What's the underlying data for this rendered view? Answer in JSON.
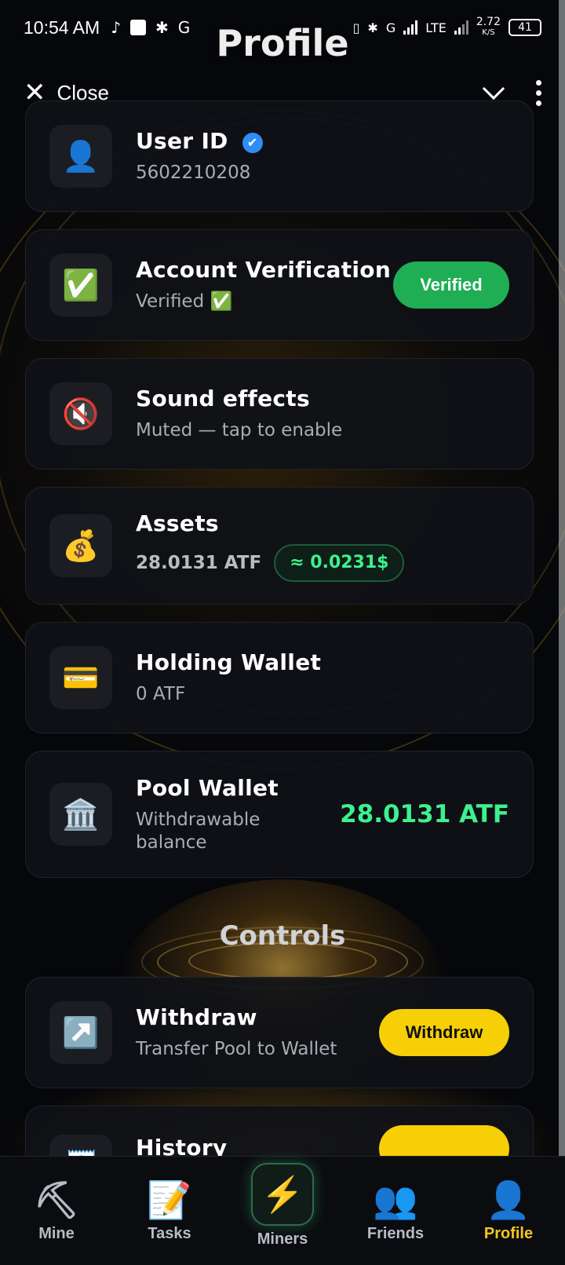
{
  "status_bar": {
    "time": "10:54 AM",
    "network_speed": "2.72",
    "network_speed_unit": "K/S",
    "battery": "41",
    "lte": "LTE",
    "g": "G"
  },
  "header": {
    "title": "Profile",
    "close_label": "Close"
  },
  "cards": {
    "user_id": {
      "title": "User ID",
      "value": "5602210208",
      "icon": "👤"
    },
    "verification": {
      "title": "Account Verification",
      "subtitle": "Verified ✅",
      "button": "Verified",
      "icon": "✅"
    },
    "sound": {
      "title": "Sound effects",
      "subtitle": "Muted — tap to enable",
      "icon": "🔇"
    },
    "assets": {
      "title": "Assets",
      "amount": "28.0131 ATF",
      "usd": "≈ 0.0231$",
      "icon": "💰"
    },
    "holding": {
      "title": "Holding Wallet",
      "subtitle": "0 ATF",
      "icon": "💳"
    },
    "pool": {
      "title": "Pool Wallet",
      "subtitle": "Withdrawable balance",
      "amount": "28.0131 ATF",
      "icon": "🏛️"
    },
    "withdraw": {
      "title": "Withdraw",
      "subtitle": "Transfer Pool to Wallet",
      "button": "Withdraw",
      "icon": "↗️"
    },
    "history": {
      "title": "History",
      "icon": "🧾"
    }
  },
  "sections": {
    "controls": "Controls"
  },
  "nav": [
    {
      "label": "Mine",
      "icon": "⛏"
    },
    {
      "label": "Tasks",
      "icon": "📝"
    },
    {
      "label": "Miners",
      "icon": "⚡"
    },
    {
      "label": "Friends",
      "icon": "👥"
    },
    {
      "label": "Profile",
      "icon": "👤"
    }
  ],
  "colors": {
    "accent_green": "#3ef08e",
    "button_green": "#1fae54",
    "button_yellow": "#f7cf06",
    "active_nav": "#f6c71e",
    "verified_badge": "#2f8df5"
  }
}
